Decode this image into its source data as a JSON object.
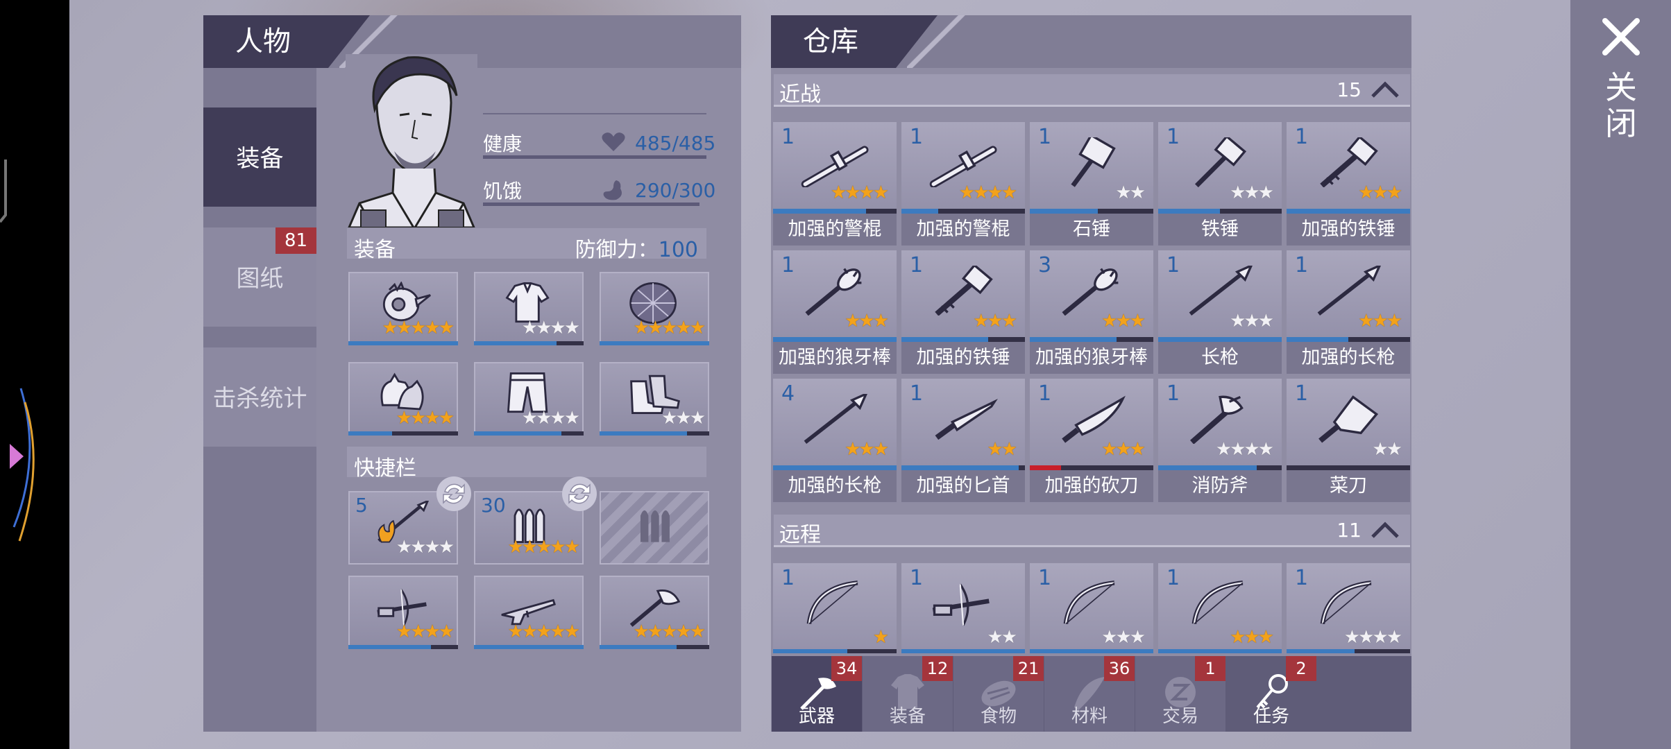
{
  "close": {
    "label": "关闭"
  },
  "character": {
    "title": "人物",
    "nav": [
      {
        "label": "装备",
        "badge": ""
      },
      {
        "label": "图纸",
        "badge": "81"
      },
      {
        "label": "击杀统计",
        "badge": ""
      }
    ],
    "health": {
      "label": "健康",
      "value": "485/485",
      "level": 1.0
    },
    "hunger": {
      "label": "饥饿",
      "value": "290/300",
      "level": 0.97
    },
    "equipment": {
      "label": "装备",
      "defense_label": "防御力：",
      "defense_value": "100",
      "slots": [
        {
          "icon": "helmet-icon",
          "stars": 5,
          "max": 5,
          "durability": 1.0
        },
        {
          "icon": "shirt-icon",
          "stars": 0,
          "max": 4,
          "durability": 0.75
        },
        {
          "icon": "shell-armor-icon",
          "stars": 5,
          "max": 5,
          "durability": 1.0
        },
        {
          "icon": "gloves-icon",
          "stars": 4,
          "max": 4,
          "durability": 0.4
        },
        {
          "icon": "pants-icon",
          "stars": 0,
          "max": 4,
          "durability": 0.8
        },
        {
          "icon": "shoes-icon",
          "stars": 0,
          "max": 3,
          "durability": 0.8
        }
      ]
    },
    "quickbar": {
      "label": "快捷栏",
      "slots": [
        {
          "icon": "fire-spear-icon",
          "qty": "5",
          "stars": 0,
          "max": 4,
          "durability": 0,
          "swap": true
        },
        {
          "icon": "bullets-icon",
          "qty": "30",
          "stars": 5,
          "max": 5,
          "durability": 0,
          "swap": true
        },
        {
          "icon": "locked-icon",
          "qty": "",
          "stars": 0,
          "max": 0,
          "durability": 0,
          "swap": false
        },
        {
          "icon": "crossbow-icon",
          "qty": "",
          "stars": 4,
          "max": 4,
          "durability": 0.75,
          "swap": false
        },
        {
          "icon": "rifle-icon",
          "qty": "",
          "stars": 5,
          "max": 5,
          "durability": 1.0,
          "swap": false
        },
        {
          "icon": "axe-icon",
          "qty": "",
          "stars": 5,
          "max": 5,
          "durability": 0.7,
          "swap": false
        }
      ]
    }
  },
  "warehouse": {
    "title": "仓库",
    "melee": {
      "label": "近战",
      "count": "15",
      "items": [
        {
          "name": "加强的警棍",
          "qty": "1",
          "stars": 4,
          "max": 4,
          "durability": 0.75,
          "icon": "baton-icon"
        },
        {
          "name": "加强的警棍",
          "qty": "1",
          "stars": 4,
          "max": 4,
          "durability": 0.3,
          "icon": "baton-icon"
        },
        {
          "name": "石锤",
          "qty": "1",
          "stars": 0,
          "max": 2,
          "durability": 0.55,
          "icon": "stone-hammer-icon"
        },
        {
          "name": "铁锤",
          "qty": "1",
          "stars": 0,
          "max": 3,
          "durability": 0.5,
          "icon": "iron-hammer-icon"
        },
        {
          "name": "加强的铁锤",
          "qty": "1",
          "stars": 3,
          "max": 3,
          "durability": 1.0,
          "icon": "reinforced-hammer-icon"
        },
        {
          "name": "加强的狼牙棒",
          "qty": "1",
          "stars": 3,
          "max": 3,
          "durability": 1.0,
          "icon": "mace-icon"
        },
        {
          "name": "加强的铁锤",
          "qty": "1",
          "stars": 3,
          "max": 3,
          "durability": 0.7,
          "icon": "reinforced-hammer-icon"
        },
        {
          "name": "加强的狼牙棒",
          "qty": "3",
          "stars": 3,
          "max": 3,
          "durability": 0.7,
          "icon": "mace-icon"
        },
        {
          "name": "长枪",
          "qty": "1",
          "stars": 0,
          "max": 3,
          "durability": 1.0,
          "icon": "spear-icon"
        },
        {
          "name": "加强的长枪",
          "qty": "1",
          "stars": 3,
          "max": 3,
          "durability": 0.5,
          "icon": "spear-icon"
        },
        {
          "name": "加强的长枪",
          "qty": "4",
          "stars": 3,
          "max": 3,
          "durability": 1.0,
          "icon": "spear-icon"
        },
        {
          "name": "加强的匕首",
          "qty": "1",
          "stars": 2,
          "max": 2,
          "durability": 0.95,
          "icon": "dagger-icon"
        },
        {
          "name": "加强的砍刀",
          "qty": "1",
          "stars": 3,
          "max": 3,
          "durability": 0.25,
          "red": true,
          "icon": "machete-icon"
        },
        {
          "name": "消防斧",
          "qty": "1",
          "stars": 0,
          "max": 4,
          "durability": 0.8,
          "icon": "fire-axe-icon"
        },
        {
          "name": "菜刀",
          "qty": "1",
          "stars": 0,
          "max": 2,
          "durability": 0.0,
          "icon": "cleaver-icon"
        }
      ]
    },
    "ranged": {
      "label": "远程",
      "count": "11",
      "items": [
        {
          "qty": "1",
          "stars": 1,
          "max": 1,
          "durability": 0.6,
          "icon": "bow-icon"
        },
        {
          "qty": "1",
          "stars": 0,
          "max": 2,
          "durability": 1.0,
          "icon": "crossbow-icon"
        },
        {
          "qty": "1",
          "stars": 0,
          "max": 3,
          "durability": 1.0,
          "icon": "bow-icon"
        },
        {
          "qty": "1",
          "stars": 3,
          "max": 3,
          "durability": 1.0,
          "icon": "bow-icon"
        },
        {
          "qty": "1",
          "stars": 0,
          "max": 4,
          "durability": 0.55,
          "icon": "bow-icon"
        }
      ]
    },
    "tabs": [
      {
        "label": "武器",
        "badge": "34",
        "icon": "weapon-tab-icon",
        "active": true
      },
      {
        "label": "装备",
        "badge": "12",
        "icon": "equipment-tab-icon",
        "active": false
      },
      {
        "label": "食物",
        "badge": "21",
        "icon": "food-tab-icon",
        "active": false
      },
      {
        "label": "材料",
        "badge": "36",
        "icon": "material-tab-icon",
        "active": false
      },
      {
        "label": "交易",
        "badge": "1",
        "icon": "trade-tab-icon",
        "active": false
      },
      {
        "label": "任务",
        "badge": "2",
        "icon": "task-tab-icon",
        "active": true
      }
    ]
  }
}
